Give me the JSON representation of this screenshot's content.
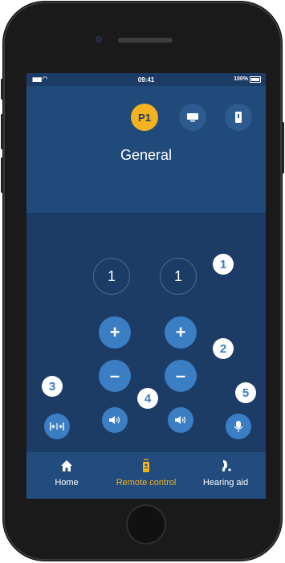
{
  "status_bar": {
    "time": "09:41",
    "battery": "100%"
  },
  "profiles": [
    {
      "label": "P1",
      "active": true
    },
    {
      "icon": "tv-icon"
    },
    {
      "icon": "phone-program-icon"
    }
  ],
  "program_title": "General",
  "volume": {
    "left": "1",
    "right": "1"
  },
  "buttons": {
    "plus": "+",
    "minus": "–"
  },
  "badges": [
    "1",
    "2",
    "3",
    "4",
    "5"
  ],
  "tabs": [
    {
      "label": "Home",
      "icon": "home-icon"
    },
    {
      "label": "Remote control",
      "icon": "remote-icon",
      "active": true
    },
    {
      "label": "Hearing aid",
      "icon": "hearing-aid-icon"
    }
  ],
  "colors": {
    "accent": "#f3b21f",
    "primary": "#3b7ec4",
    "background": "#1c3c66"
  }
}
